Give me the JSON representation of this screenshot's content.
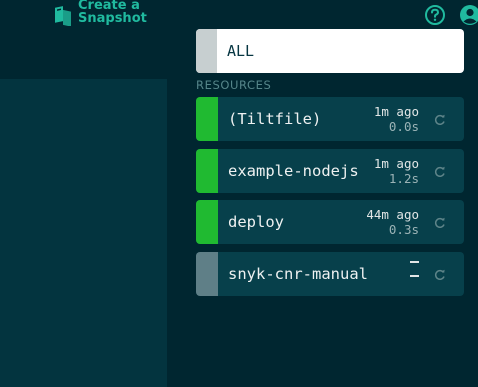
{
  "header": {
    "snapshot_button": "Create a\nSnapshot"
  },
  "colors": {
    "ok": "#20ba31",
    "pending": "#5f7f87",
    "accent": "#20ba9f"
  },
  "sidebar": {
    "all_label": "ALL",
    "section_label": "RESOURCES",
    "resources": [
      {
        "name": "(Tiltfile)",
        "updated": "1m ago",
        "duration": "0.0s",
        "status": "ok"
      },
      {
        "name": "example-nodejs",
        "updated": "1m ago",
        "duration": "1.2s",
        "status": "ok"
      },
      {
        "name": "deploy",
        "updated": "44m ago",
        "duration": "0.3s",
        "status": "ok"
      },
      {
        "name": "snyk-cnr-manual",
        "updated": "",
        "duration": "",
        "status": "pending"
      }
    ]
  }
}
